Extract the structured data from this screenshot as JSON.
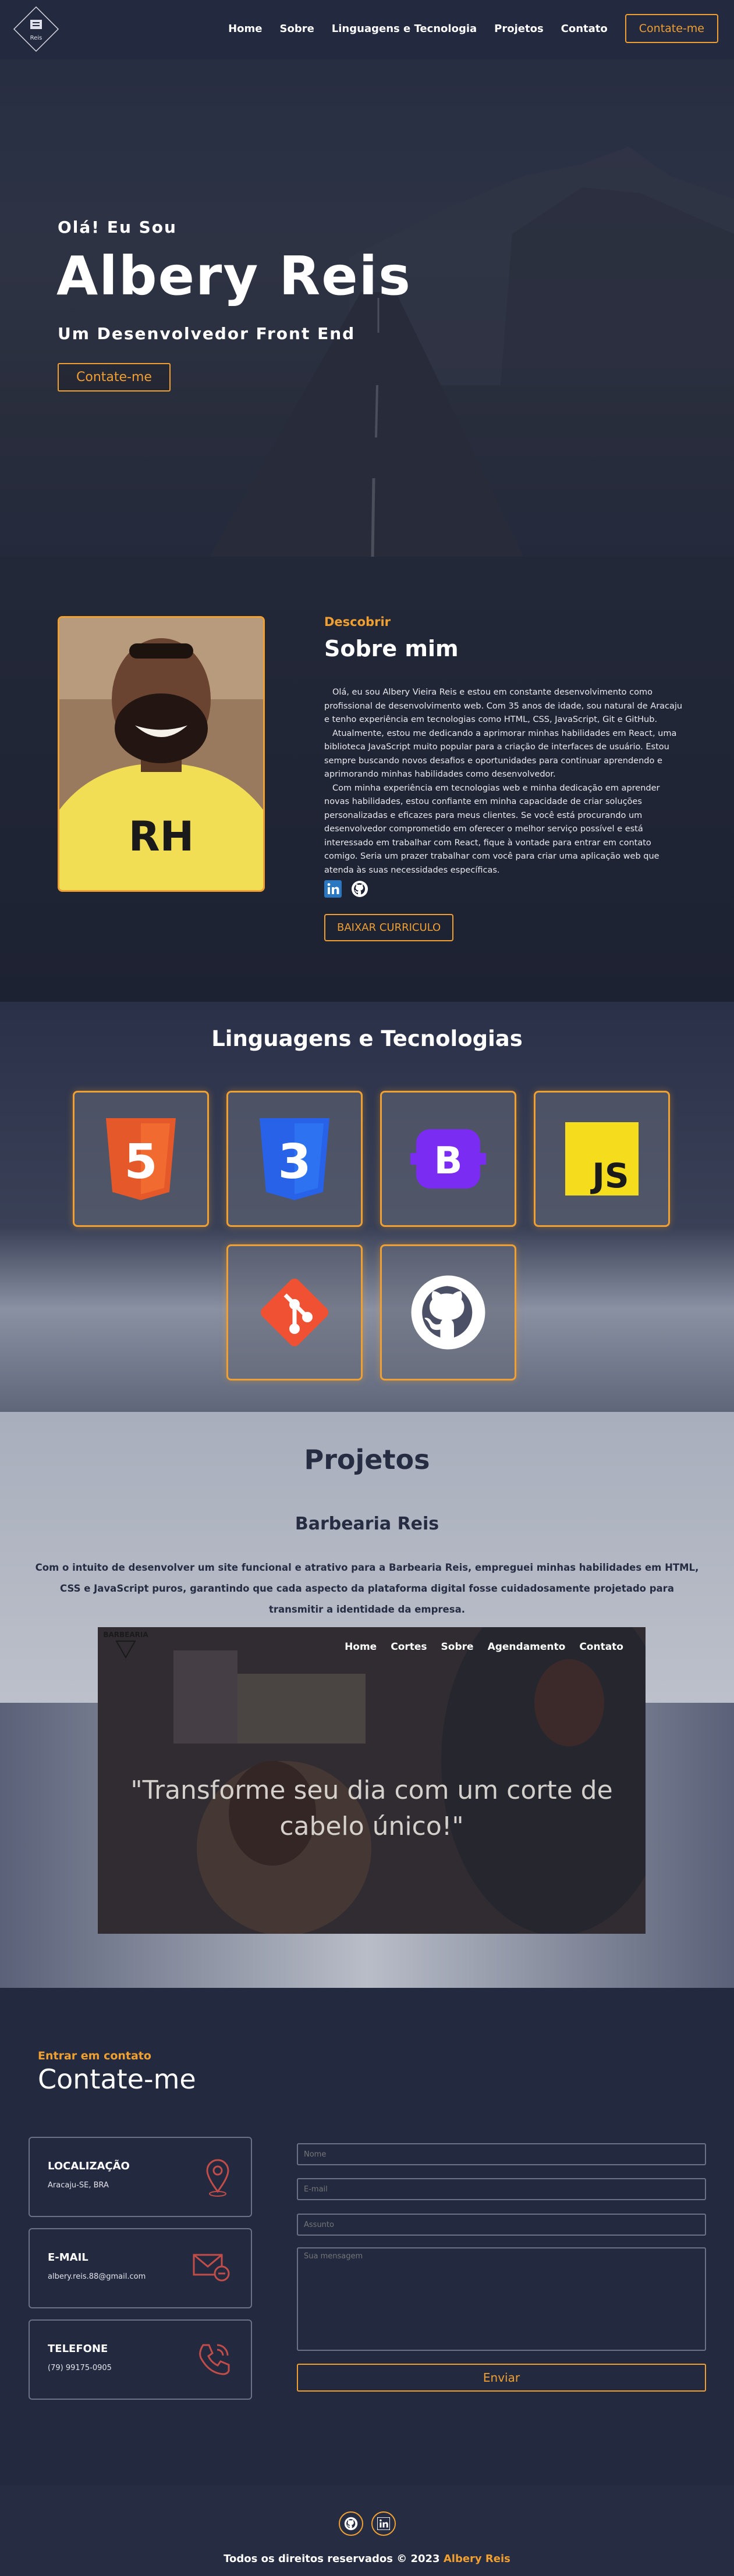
{
  "header": {
    "logo_text": "Reis",
    "nav": [
      "Home",
      "Sobre",
      "Linguagens e Tecnologia",
      "Projetos",
      "Contato"
    ],
    "cta_label": "Contate-me"
  },
  "hero": {
    "greeting": "Olá! Eu Sou",
    "name": "Albery Reis",
    "role": "Um Desenvolvedor Front End",
    "button": "Contate-me"
  },
  "about": {
    "kicker": "Descobrir",
    "title": "Sobre mim",
    "paragraphs": [
      "Olá, eu sou Albery Vieira Reis e estou em constante desenvolvimento como profissional de desenvolvimento web. Com 35 anos de idade, sou natural de Aracaju e tenho experiência em tecnologias como HTML, CSS, JavaScript, Git e GitHub.",
      "Atualmente, estou me dedicando a aprimorar minhas habilidades em React, uma biblioteca JavaScript muito popular para a criação de interfaces de usuário. Estou sempre buscando novos desafios e oportunidades para continuar aprendendo e aprimorando minhas habilidades como desenvolvedor.",
      "Com minha experiência em tecnologias web e minha dedicação em aprender novas habilidades, estou confiante em minha capacidade de criar soluções personalizadas e eficazes para meus clientes. Se você está procurando um desenvolvedor comprometido em oferecer o melhor serviço possível e está interessado em trabalhar com React, fique à vontade para entrar em contato comigo. Seria um prazer trabalhar com você para criar uma aplicação web que atenda às suas necessidades específicas."
    ],
    "cv_button": "BAIXAR CURRICULO",
    "shirt_text": "RH"
  },
  "tech": {
    "title": "Linguagens e Tecnologias",
    "items": [
      "html5-icon",
      "css3-icon",
      "bootstrap-icon",
      "javascript-icon",
      "git-icon",
      "github-icon"
    ],
    "html_glyph": "5",
    "css_glyph": "3",
    "bootstrap_glyph": "B",
    "js_glyph": "JS"
  },
  "projects": {
    "title": "Projetos",
    "project_name": "Barbearia Reis",
    "description": "Com o intuito de desenvolver um site funcional e atrativo para a Barbearia Reis, empreguei minhas habilidades em HTML, CSS e JavaScript puros, garantindo que cada aspecto da plataforma digital fosse cuidadosamente projetado para transmitir a identidade da empresa.",
    "preview": {
      "logo_text": "BARBEARIA",
      "nav": [
        "Home",
        "Cortes",
        "Sobre",
        "Agendamento",
        "Contato"
      ],
      "quote": "\"Transforme seu dia com um corte de cabelo único!\""
    }
  },
  "contact": {
    "kicker": "Entrar em contato",
    "title": "Contate-me",
    "cards": [
      {
        "label": "LOCALIZAÇÃO",
        "value": "Aracaju-SE, BRA"
      },
      {
        "label": "E-MAIL",
        "value": "albery.reis.88@gmail.com"
      },
      {
        "label": "TELEFONE",
        "value": "(79) 99175-0905"
      }
    ],
    "placeholders": {
      "name": "Nome",
      "email": "E-mail",
      "subject": "Assunto",
      "message": "Sua mensagem"
    },
    "send_button": "Enviar"
  },
  "footer": {
    "text": "Todos os direitos reservados © 2023",
    "author": "Albery Reis"
  },
  "colors": {
    "accent": "#f0a030",
    "background": "#262c42",
    "header": "#232a40"
  }
}
